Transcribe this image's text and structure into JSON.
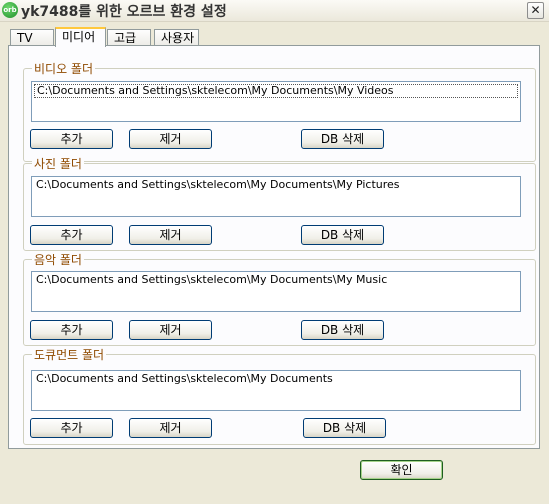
{
  "window": {
    "title": "yk7488를 위한 오르브 환경 설정",
    "app_icon_text": "orb",
    "close_label": "✕"
  },
  "tabs": [
    {
      "label": "TV",
      "active": false
    },
    {
      "label": "미디어",
      "active": true
    },
    {
      "label": "고급",
      "active": false
    },
    {
      "label": "사용자",
      "active": false
    }
  ],
  "groups": [
    {
      "title": "비디오 폴더",
      "paths": [
        "C:\\Documents and Settings\\sktelecom\\My Documents\\My Videos"
      ],
      "selected_row": 0,
      "add_label": "추가",
      "remove_label": "제거",
      "delete_db_label": "DB 삭제"
    },
    {
      "title": "사진 폴더",
      "paths": [
        "C:\\Documents and Settings\\sktelecom\\My Documents\\My Pictures"
      ],
      "add_label": "추가",
      "remove_label": "제거",
      "delete_db_label": "DB 삭제"
    },
    {
      "title": "음악 폴더",
      "paths": [
        "C:\\Documents and Settings\\sktelecom\\My Documents\\My Music"
      ],
      "add_label": "추가",
      "remove_label": "제거",
      "delete_db_label": "DB 삭제"
    },
    {
      "title": "도큐먼트 폴더",
      "paths": [
        "C:\\Documents and Settings\\sktelecom\\My Documents"
      ],
      "add_label": "추가",
      "remove_label": "제거",
      "delete_db_label": "DB 삭제"
    }
  ],
  "footer": {
    "ok_label": "확인"
  }
}
